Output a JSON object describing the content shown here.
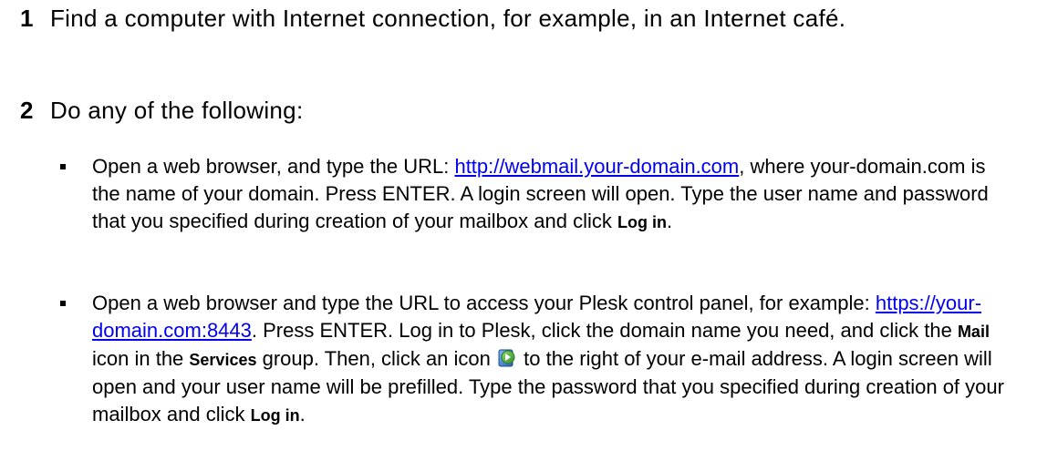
{
  "steps": [
    {
      "number": "1",
      "text": "Find a computer with Internet connection, for example, in an Internet café."
    },
    {
      "number": "2",
      "text": "Do any of the following:"
    }
  ],
  "bullets": {
    "b1": {
      "t1": "Open a web browser, and type the URL: ",
      "link": "http://webmail.your-domain.com",
      "t2": ", where your-domain.com is the name of your domain. Press ENTER. A login screen will open. Type the user name and password that you specified during creation of your mailbox and click ",
      "term": "Log in",
      "t3": "."
    },
    "b2": {
      "t1": "Open a web browser and type the URL to access your Plesk control panel, for example: ",
      "link": "https://your-domain.com:8443",
      "t2": ". Press ENTER. Log in to Plesk, click the domain name you need, and click the ",
      "term_mail": "Mail",
      "t3": " icon in the ",
      "term_services": "Services",
      "t4": " group. Then, click an icon ",
      "t5": " to the right of your e-mail address. A login screen will open and your user name will be prefilled. Type the password that you specified during creation of your mailbox and click ",
      "term_login": "Log in",
      "t6": "."
    }
  },
  "icons": {
    "webmail_icon": "webmail-open-icon"
  },
  "colors": {
    "link": "#0000ee",
    "icon_green": "#3aa23a",
    "icon_blue": "#2f6fc9"
  }
}
